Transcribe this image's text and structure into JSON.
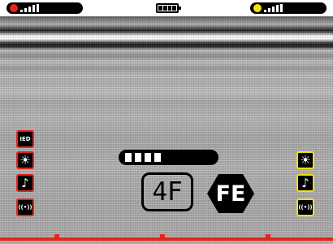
{
  "topbar": {
    "left_indicator": {
      "color": "#e3261b",
      "bars": 5
    },
    "right_indicator": {
      "color": "#f5e011",
      "bars": 5
    },
    "battery": {
      "level": 1.0
    }
  },
  "icons": {
    "left": [
      {
        "name": "mode-icon",
        "glyph": "IED"
      },
      {
        "name": "brightness-icon",
        "glyph": "☀"
      },
      {
        "name": "sound-icon",
        "glyph": "♪"
      },
      {
        "name": "vibration-icon",
        "glyph": "((•))"
      }
    ],
    "right": [
      {
        "name": "brightness-icon",
        "glyph": "☀"
      },
      {
        "name": "sound-icon",
        "glyph": "♪"
      },
      {
        "name": "vibration-icon",
        "glyph": "((•))"
      }
    ]
  },
  "signal": {
    "filled_segments": 4
  },
  "readout": {
    "depth": "4F",
    "material": "FE"
  },
  "colors": {
    "accent_red": "#e3261b",
    "accent_yellow": "#f5e011"
  }
}
